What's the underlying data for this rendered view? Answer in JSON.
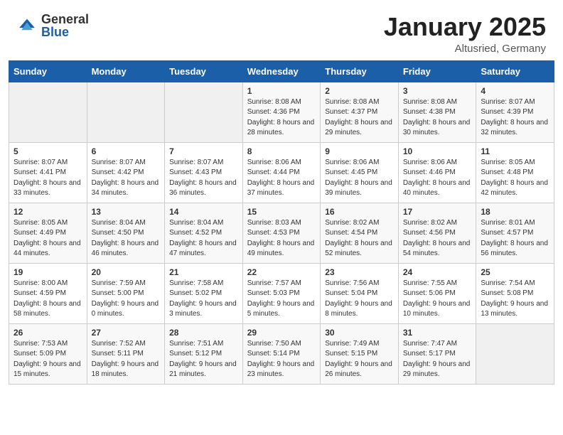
{
  "header": {
    "logo_general": "General",
    "logo_blue": "Blue",
    "month_title": "January 2025",
    "location": "Altusried, Germany"
  },
  "days_of_week": [
    "Sunday",
    "Monday",
    "Tuesday",
    "Wednesday",
    "Thursday",
    "Friday",
    "Saturday"
  ],
  "weeks": [
    [
      {
        "day": "",
        "sunrise": "",
        "sunset": "",
        "daylight": ""
      },
      {
        "day": "",
        "sunrise": "",
        "sunset": "",
        "daylight": ""
      },
      {
        "day": "",
        "sunrise": "",
        "sunset": "",
        "daylight": ""
      },
      {
        "day": "1",
        "sunrise": "Sunrise: 8:08 AM",
        "sunset": "Sunset: 4:36 PM",
        "daylight": "Daylight: 8 hours and 28 minutes."
      },
      {
        "day": "2",
        "sunrise": "Sunrise: 8:08 AM",
        "sunset": "Sunset: 4:37 PM",
        "daylight": "Daylight: 8 hours and 29 minutes."
      },
      {
        "day": "3",
        "sunrise": "Sunrise: 8:08 AM",
        "sunset": "Sunset: 4:38 PM",
        "daylight": "Daylight: 8 hours and 30 minutes."
      },
      {
        "day": "4",
        "sunrise": "Sunrise: 8:07 AM",
        "sunset": "Sunset: 4:39 PM",
        "daylight": "Daylight: 8 hours and 32 minutes."
      }
    ],
    [
      {
        "day": "5",
        "sunrise": "Sunrise: 8:07 AM",
        "sunset": "Sunset: 4:41 PM",
        "daylight": "Daylight: 8 hours and 33 minutes."
      },
      {
        "day": "6",
        "sunrise": "Sunrise: 8:07 AM",
        "sunset": "Sunset: 4:42 PM",
        "daylight": "Daylight: 8 hours and 34 minutes."
      },
      {
        "day": "7",
        "sunrise": "Sunrise: 8:07 AM",
        "sunset": "Sunset: 4:43 PM",
        "daylight": "Daylight: 8 hours and 36 minutes."
      },
      {
        "day": "8",
        "sunrise": "Sunrise: 8:06 AM",
        "sunset": "Sunset: 4:44 PM",
        "daylight": "Daylight: 8 hours and 37 minutes."
      },
      {
        "day": "9",
        "sunrise": "Sunrise: 8:06 AM",
        "sunset": "Sunset: 4:45 PM",
        "daylight": "Daylight: 8 hours and 39 minutes."
      },
      {
        "day": "10",
        "sunrise": "Sunrise: 8:06 AM",
        "sunset": "Sunset: 4:46 PM",
        "daylight": "Daylight: 8 hours and 40 minutes."
      },
      {
        "day": "11",
        "sunrise": "Sunrise: 8:05 AM",
        "sunset": "Sunset: 4:48 PM",
        "daylight": "Daylight: 8 hours and 42 minutes."
      }
    ],
    [
      {
        "day": "12",
        "sunrise": "Sunrise: 8:05 AM",
        "sunset": "Sunset: 4:49 PM",
        "daylight": "Daylight: 8 hours and 44 minutes."
      },
      {
        "day": "13",
        "sunrise": "Sunrise: 8:04 AM",
        "sunset": "Sunset: 4:50 PM",
        "daylight": "Daylight: 8 hours and 46 minutes."
      },
      {
        "day": "14",
        "sunrise": "Sunrise: 8:04 AM",
        "sunset": "Sunset: 4:52 PM",
        "daylight": "Daylight: 8 hours and 47 minutes."
      },
      {
        "day": "15",
        "sunrise": "Sunrise: 8:03 AM",
        "sunset": "Sunset: 4:53 PM",
        "daylight": "Daylight: 8 hours and 49 minutes."
      },
      {
        "day": "16",
        "sunrise": "Sunrise: 8:02 AM",
        "sunset": "Sunset: 4:54 PM",
        "daylight": "Daylight: 8 hours and 52 minutes."
      },
      {
        "day": "17",
        "sunrise": "Sunrise: 8:02 AM",
        "sunset": "Sunset: 4:56 PM",
        "daylight": "Daylight: 8 hours and 54 minutes."
      },
      {
        "day": "18",
        "sunrise": "Sunrise: 8:01 AM",
        "sunset": "Sunset: 4:57 PM",
        "daylight": "Daylight: 8 hours and 56 minutes."
      }
    ],
    [
      {
        "day": "19",
        "sunrise": "Sunrise: 8:00 AM",
        "sunset": "Sunset: 4:59 PM",
        "daylight": "Daylight: 8 hours and 58 minutes."
      },
      {
        "day": "20",
        "sunrise": "Sunrise: 7:59 AM",
        "sunset": "Sunset: 5:00 PM",
        "daylight": "Daylight: 9 hours and 0 minutes."
      },
      {
        "day": "21",
        "sunrise": "Sunrise: 7:58 AM",
        "sunset": "Sunset: 5:02 PM",
        "daylight": "Daylight: 9 hours and 3 minutes."
      },
      {
        "day": "22",
        "sunrise": "Sunrise: 7:57 AM",
        "sunset": "Sunset: 5:03 PM",
        "daylight": "Daylight: 9 hours and 5 minutes."
      },
      {
        "day": "23",
        "sunrise": "Sunrise: 7:56 AM",
        "sunset": "Sunset: 5:04 PM",
        "daylight": "Daylight: 9 hours and 8 minutes."
      },
      {
        "day": "24",
        "sunrise": "Sunrise: 7:55 AM",
        "sunset": "Sunset: 5:06 PM",
        "daylight": "Daylight: 9 hours and 10 minutes."
      },
      {
        "day": "25",
        "sunrise": "Sunrise: 7:54 AM",
        "sunset": "Sunset: 5:08 PM",
        "daylight": "Daylight: 9 hours and 13 minutes."
      }
    ],
    [
      {
        "day": "26",
        "sunrise": "Sunrise: 7:53 AM",
        "sunset": "Sunset: 5:09 PM",
        "daylight": "Daylight: 9 hours and 15 minutes."
      },
      {
        "day": "27",
        "sunrise": "Sunrise: 7:52 AM",
        "sunset": "Sunset: 5:11 PM",
        "daylight": "Daylight: 9 hours and 18 minutes."
      },
      {
        "day": "28",
        "sunrise": "Sunrise: 7:51 AM",
        "sunset": "Sunset: 5:12 PM",
        "daylight": "Daylight: 9 hours and 21 minutes."
      },
      {
        "day": "29",
        "sunrise": "Sunrise: 7:50 AM",
        "sunset": "Sunset: 5:14 PM",
        "daylight": "Daylight: 9 hours and 23 minutes."
      },
      {
        "day": "30",
        "sunrise": "Sunrise: 7:49 AM",
        "sunset": "Sunset: 5:15 PM",
        "daylight": "Daylight: 9 hours and 26 minutes."
      },
      {
        "day": "31",
        "sunrise": "Sunrise: 7:47 AM",
        "sunset": "Sunset: 5:17 PM",
        "daylight": "Daylight: 9 hours and 29 minutes."
      },
      {
        "day": "",
        "sunrise": "",
        "sunset": "",
        "daylight": ""
      }
    ]
  ]
}
